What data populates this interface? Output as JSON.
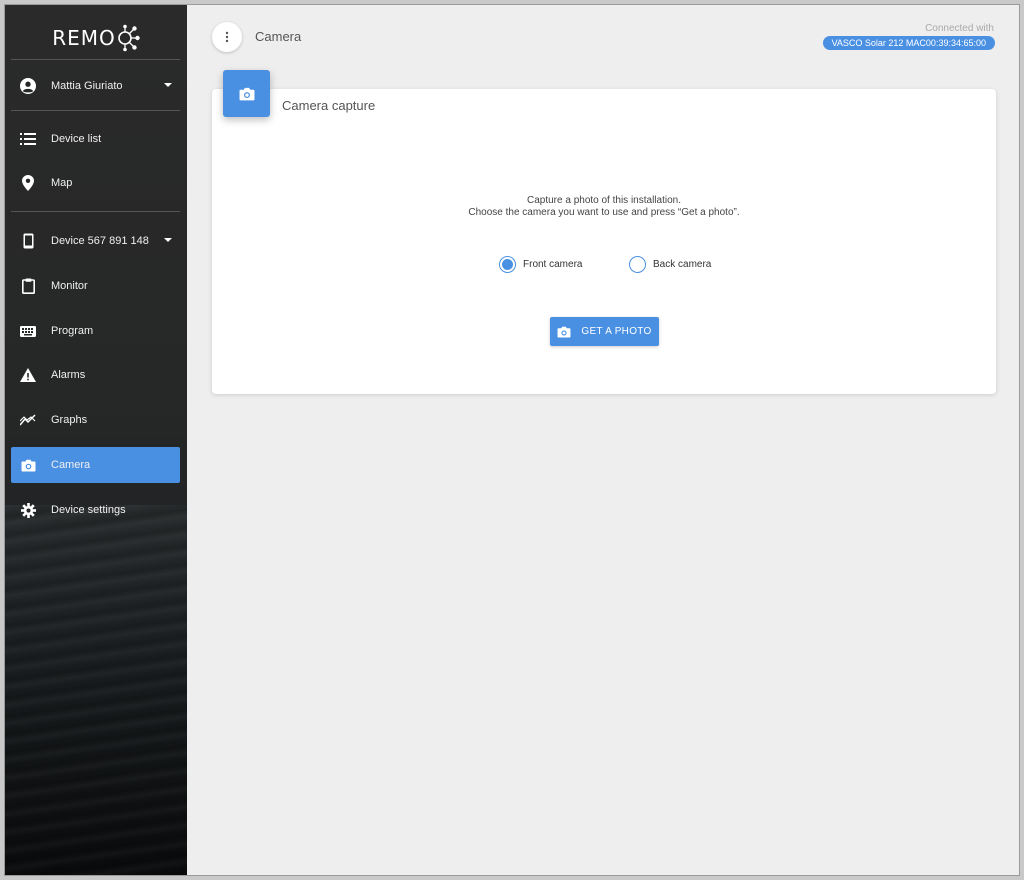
{
  "app": {
    "logo_text": "REMO"
  },
  "user": {
    "name": "Mattia Giuriato"
  },
  "nav_top": [
    {
      "label": "Device list",
      "icon": "list-icon"
    },
    {
      "label": "Map",
      "icon": "map-pin-icon"
    }
  ],
  "device": {
    "label": "Device 567 891 148"
  },
  "nav_device": [
    {
      "label": "Monitor",
      "icon": "clipboard-icon"
    },
    {
      "label": "Program",
      "icon": "keyboard-icon"
    },
    {
      "label": "Alarms",
      "icon": "warning-icon"
    },
    {
      "label": "Graphs",
      "icon": "graph-icon"
    },
    {
      "label": "Camera",
      "icon": "camera-icon",
      "active": true
    },
    {
      "label": "Device settings",
      "icon": "gear-icon"
    }
  ],
  "header": {
    "title": "Camera",
    "connected_label": "Connected with",
    "connection_badge": "VASCO Solar 212  MAC00:39:34:65:00"
  },
  "card": {
    "title": "Camera capture",
    "description_line1": "Capture a photo of this installation.",
    "description_line2": "Choose the camera you want to use and press “Get a photo”.",
    "options": [
      {
        "label": "Front camera",
        "selected": true
      },
      {
        "label": "Back camera",
        "selected": false
      }
    ],
    "button_label": "GET A PHOTO"
  },
  "colors": {
    "accent": "#4a90e2",
    "sidebar_bg": "#262727",
    "page_bg": "#eeeeee"
  }
}
